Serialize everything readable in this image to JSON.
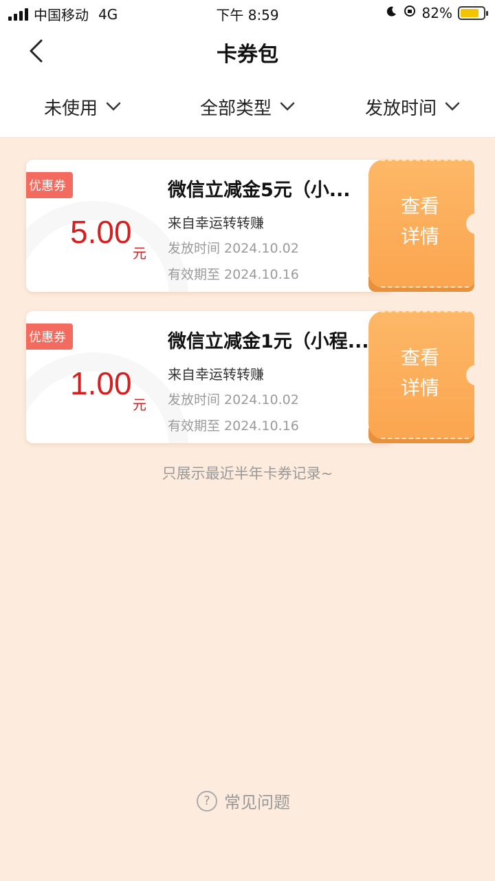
{
  "status_bar": {
    "carrier": "中国移动",
    "network": "4G",
    "time": "下午 8:59",
    "battery_percent": "82%",
    "battery_level": 0.82
  },
  "nav": {
    "title": "卡券包"
  },
  "filters": [
    {
      "label": "未使用"
    },
    {
      "label": "全部类型"
    },
    {
      "label": "发放时间"
    }
  ],
  "coupons": [
    {
      "badge": "优惠券",
      "amount": "5.00",
      "unit": "元",
      "title": "微信立减金5元（小...",
      "source": "来自幸运转转赚",
      "issued": "发放时间 2024.10.02",
      "valid_until": "有效期至 2024.10.16",
      "action_line1": "查看",
      "action_line2": "详情"
    },
    {
      "badge": "优惠券",
      "amount": "1.00",
      "unit": "元",
      "title": "微信立减金1元（小程...",
      "source": "来自幸运转转赚",
      "issued": "发放时间 2024.10.02",
      "valid_until": "有效期至 2024.10.16",
      "action_line1": "查看",
      "action_line2": "详情"
    }
  ],
  "footer": {
    "note": "只展示最近半年卡券记录~",
    "faq_label": "常见问题",
    "faq_icon": "?"
  },
  "colors": {
    "background": "#fdebdd",
    "amount_red": "#d71e1e",
    "badge": "#f26b5e",
    "stub_orange": "#fba54f"
  }
}
